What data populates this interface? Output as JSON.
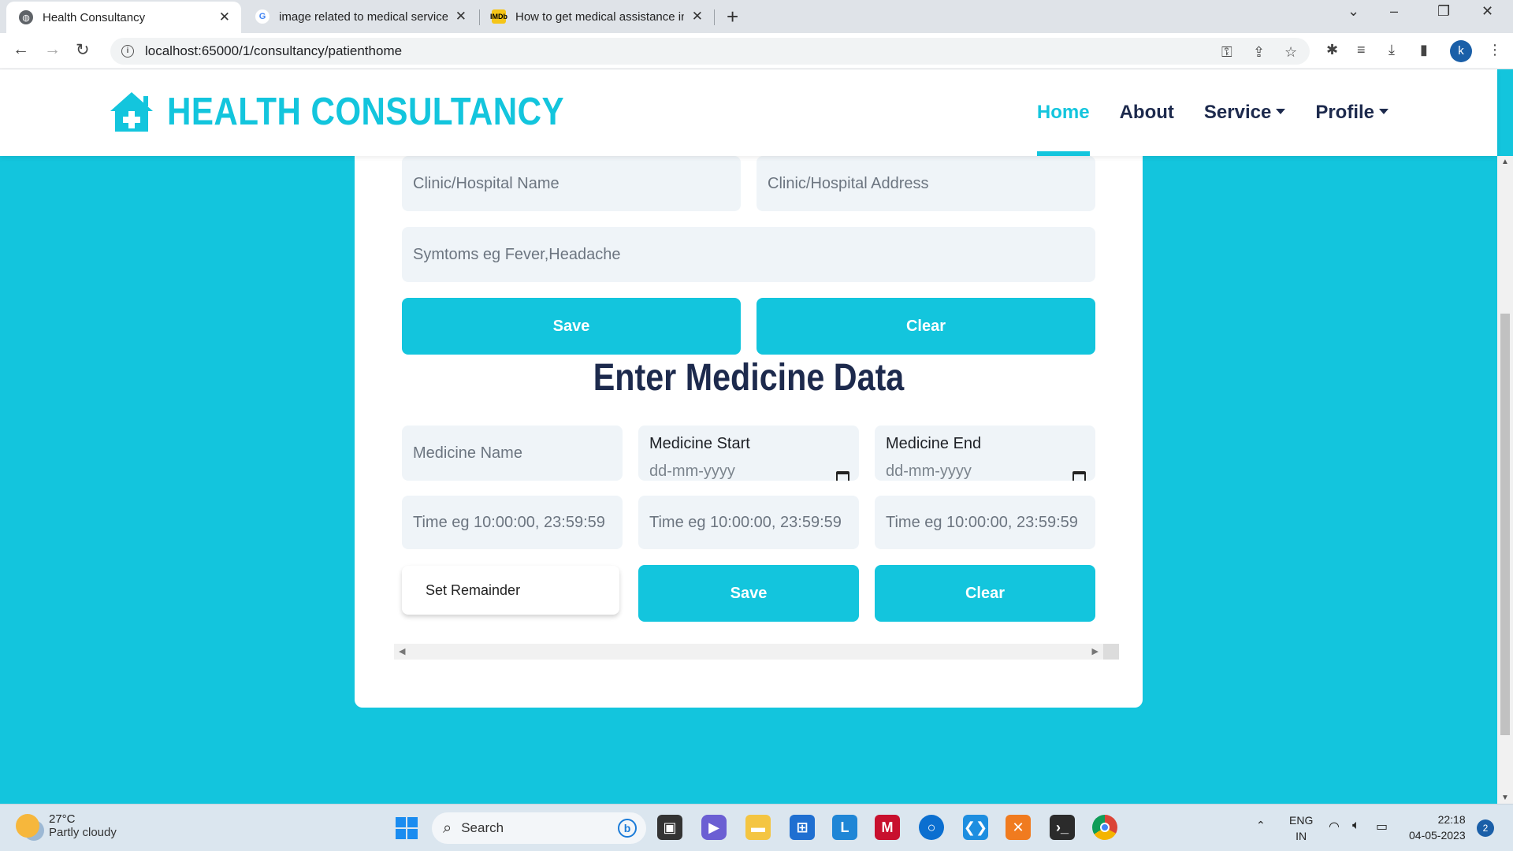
{
  "browser": {
    "tabs": [
      {
        "title": "Health Consultancy",
        "active": true,
        "favicon": "globe-icon"
      },
      {
        "title": "image related to medical services",
        "active": false,
        "favicon": "google-icon"
      },
      {
        "title": "How to get medical assistance in",
        "active": false,
        "favicon": "imdb-icon"
      }
    ],
    "url": "localhost:65000/1/consultancy/patienthome",
    "profile_initial": "k"
  },
  "site": {
    "brand": "HEALTH CONSULTANCY",
    "brand_color": "#13c5dd",
    "nav": [
      {
        "label": "Home",
        "active": true
      },
      {
        "label": "About",
        "active": false
      },
      {
        "label": "Service",
        "dropdown": true
      },
      {
        "label": "Profile",
        "dropdown": true
      }
    ]
  },
  "consult_form": {
    "clinic_name_placeholder": "Clinic/Hospital Name",
    "clinic_address_placeholder": "Clinic/Hospital Address",
    "symptoms_placeholder": "Symtoms eg Fever,Headache",
    "save_label": "Save",
    "clear_label": "Clear"
  },
  "medicine_form": {
    "title": "Enter Medicine Data",
    "name_placeholder": "Medicine Name",
    "start_label": "Medicine Start",
    "end_label": "Medicine End",
    "date_placeholder": "dd-mm-yyyy",
    "time_placeholder": "Time eg 10:00:00, 23:59:59",
    "reminder_label": "Set Remainder",
    "save_label": "Save",
    "clear_label": "Clear"
  },
  "taskbar": {
    "weather_temp": "27°C",
    "weather_desc": "Partly cloudy",
    "search_label": "Search",
    "lang_line1": "ENG",
    "lang_line2": "IN",
    "time": "22:18",
    "date": "04-05-2023",
    "notification_count": "2"
  }
}
